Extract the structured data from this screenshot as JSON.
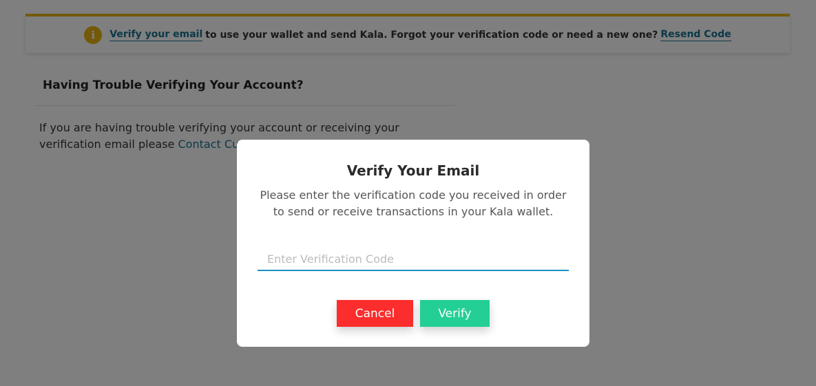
{
  "banner": {
    "verify_link": "Verify your email",
    "text": "to use your wallet and send Kala. Forgot your verification code or need a new one?",
    "resend_link": "Resend Code",
    "icon_glyph": "i",
    "icon": "info-icon",
    "accent_color": "#e8b313"
  },
  "trouble": {
    "title": "Having Trouble Verifying Your Account?",
    "body": "If you are having trouble verifying your account or receiving your verification email please",
    "contact_link": "Contact Customer Support"
  },
  "modal": {
    "title": "Verify Your Email",
    "description": "Please enter the verification code you received in order to send or receive transactions in your Kala wallet.",
    "input_placeholder": "Enter Verification Code",
    "input_value": "",
    "cancel_label": "Cancel",
    "verify_label": "Verify",
    "cancel_color": "#fb2d2d",
    "verify_color": "#23cf94",
    "input_accent": "#1a8ec2"
  }
}
